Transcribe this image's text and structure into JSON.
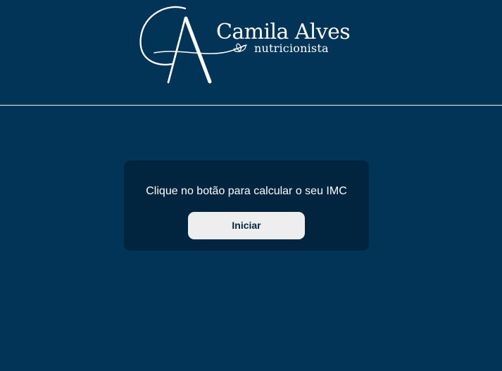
{
  "colors": {
    "background": "#013457",
    "card": "#02253f",
    "button": "#eeeeee",
    "text": "#ffffff"
  },
  "logo": {
    "name": "Camila Alves",
    "subtitle": "nutricionista",
    "icon": "flower-icon"
  },
  "main": {
    "message": "Clique no botão para calcular o seu IMC",
    "start_button_label": "Iniciar"
  }
}
